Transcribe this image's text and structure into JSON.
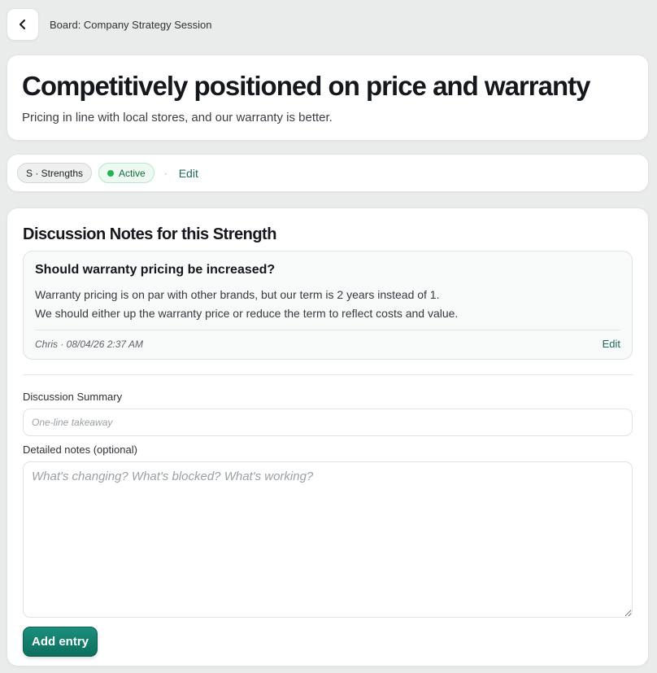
{
  "breadcrumb": "Board: Company Strategy Session",
  "item": {
    "title": "Competitively positioned on price and warranty",
    "description": "Pricing in line with local stores, and our warranty is better.",
    "category": "S · Strengths",
    "status": "Active",
    "separator": "·",
    "edit_label": "Edit"
  },
  "notes": {
    "heading": "Discussion Notes for this Strength",
    "entries": [
      {
        "title": "Should warranty pricing be increased?",
        "lines": [
          "Warranty pricing is on par with other brands, but our term is 2 years instead of 1.",
          "We should either up the warranty price or reduce the term to reflect costs and value."
        ],
        "author_line": "Chris · 08/04/26 2:37 AM",
        "edit_label": "Edit"
      }
    ]
  },
  "form": {
    "summary_label": "Discussion Summary",
    "summary_placeholder": "One-line takeaway",
    "details_label": "Detailed notes (optional)",
    "details_placeholder": "What's changing? What's blocked? What's working?",
    "submit_label": "Add entry"
  },
  "colors": {
    "accent": "#1d6a5c",
    "button": "#0e6e5e",
    "status_dot": "#22b455"
  },
  "icons": {
    "back": "chevron-left-icon"
  }
}
